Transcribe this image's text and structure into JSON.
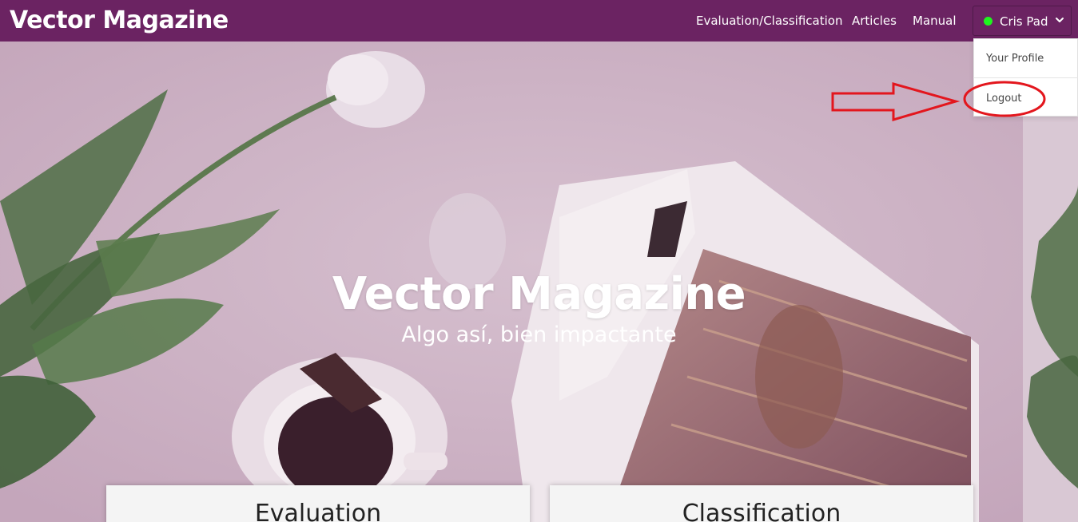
{
  "navbar": {
    "brand": "Vector Magazine",
    "links": [
      "Evaluation/Classification",
      "Articles",
      "Manual"
    ],
    "user": {
      "name": "Cris Pad",
      "status_color": "#1ef51e",
      "dropdown_icon": "chevron-down-icon"
    },
    "background": "#6b2362"
  },
  "user_menu": {
    "items": [
      "Your Profile",
      "Logout"
    ]
  },
  "hero": {
    "title": "Vector Magazine",
    "subtitle": "Algo así, bien impactante"
  },
  "cards": [
    "Evaluation",
    "Classification"
  ],
  "annotation": {
    "arrow_color": "#e3161d",
    "target": "Logout"
  }
}
